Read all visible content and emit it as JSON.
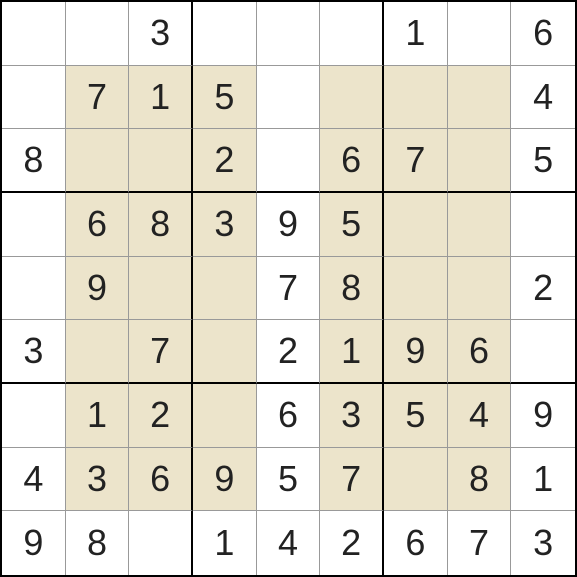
{
  "sudoku": {
    "grid": [
      [
        "",
        "",
        "3",
        "",
        "",
        "",
        "1",
        "",
        "6"
      ],
      [
        "",
        "7",
        "1",
        "5",
        "",
        "",
        "",
        "",
        "4"
      ],
      [
        "8",
        "",
        "",
        "2",
        "",
        "6",
        "7",
        "",
        "5"
      ],
      [
        "",
        "6",
        "8",
        "3",
        "9",
        "5",
        "",
        "",
        ""
      ],
      [
        "",
        "9",
        "",
        "",
        "7",
        "8",
        "",
        "",
        "2"
      ],
      [
        "3",
        "",
        "7",
        "",
        "2",
        "1",
        "9",
        "6",
        ""
      ],
      [
        "",
        "1",
        "2",
        "",
        "6",
        "3",
        "5",
        "4",
        "9"
      ],
      [
        "4",
        "3",
        "6",
        "9",
        "5",
        "7",
        "",
        "8",
        "1"
      ],
      [
        "9",
        "8",
        "",
        "1",
        "4",
        "2",
        "6",
        "7",
        "3"
      ]
    ],
    "highlight_regions": [
      {
        "rows": [
          1,
          2,
          3
        ],
        "cols": [
          1,
          2,
          3
        ]
      },
      {
        "rows": [
          1,
          2,
          3
        ],
        "cols": [
          7,
          8,
          9
        ]
      },
      {
        "rows": [
          4,
          5,
          6
        ],
        "cols": [
          4,
          5,
          6
        ]
      },
      {
        "rows": [
          7,
          8,
          9
        ],
        "cols": [
          1,
          2,
          3
        ]
      },
      {
        "rows": [
          7,
          8,
          9
        ],
        "cols": [
          7,
          8,
          9
        ]
      }
    ],
    "highlighted_cells": [
      [
        1,
        1
      ],
      [
        1,
        2
      ],
      [
        1,
        3
      ],
      [
        1,
        5
      ],
      [
        1,
        6
      ],
      [
        1,
        7
      ],
      [
        2,
        1
      ],
      [
        2,
        2
      ],
      [
        2,
        3
      ],
      [
        2,
        5
      ],
      [
        2,
        6
      ],
      [
        2,
        7
      ],
      [
        3,
        1
      ],
      [
        3,
        2
      ],
      [
        3,
        3
      ],
      [
        3,
        5
      ],
      [
        3,
        6
      ],
      [
        3,
        7
      ],
      [
        4,
        1
      ],
      [
        4,
        2
      ],
      [
        4,
        3
      ],
      [
        4,
        5
      ],
      [
        4,
        6
      ],
      [
        4,
        7
      ],
      [
        5,
        1
      ],
      [
        5,
        2
      ],
      [
        5,
        3
      ],
      [
        5,
        5
      ],
      [
        5,
        6
      ],
      [
        5,
        7
      ],
      [
        6,
        1
      ],
      [
        6,
        2
      ],
      [
        6,
        3
      ],
      [
        6,
        5
      ],
      [
        6,
        6
      ],
      [
        6,
        7
      ],
      [
        7,
        1
      ],
      [
        7,
        2
      ],
      [
        7,
        3
      ],
      [
        7,
        5
      ],
      [
        7,
        6
      ],
      [
        7,
        7
      ]
    ]
  }
}
